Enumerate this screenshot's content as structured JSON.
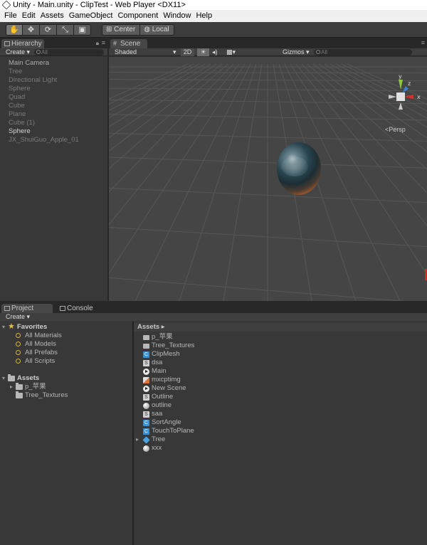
{
  "window": {
    "title": "Unity - Main.unity - ClipTest - Web Player <DX11>"
  },
  "menu": [
    "File",
    "Edit",
    "Assets",
    "GameObject",
    "Component",
    "Window",
    "Help"
  ],
  "toolbar": {
    "tools": [
      "hand-tool",
      "move-tool",
      "rotate-tool",
      "scale-tool",
      "rect-tool"
    ],
    "tool_glyphs": [
      "✋",
      "✥",
      "⟳",
      "⤡",
      "▣"
    ],
    "pivot_label": "Center",
    "space_label": "Local"
  },
  "hierarchy": {
    "tab": "Hierarchy",
    "create": "Create ▾",
    "search_placeholder": "All",
    "items": [
      {
        "label": "Main Camera",
        "style": ""
      },
      {
        "label": "Tree",
        "style": "dim"
      },
      {
        "label": "Directional Light",
        "style": "dim"
      },
      {
        "label": "Sphere",
        "style": "dim"
      },
      {
        "label": "Quad",
        "style": "dim"
      },
      {
        "label": "Cube",
        "style": "dim"
      },
      {
        "label": "Plane",
        "style": "dim"
      },
      {
        "label": "Cube (1)",
        "style": "dim"
      },
      {
        "label": "Sphere",
        "style": "bold"
      },
      {
        "label": "JX_ShuiGuo_Apple_01",
        "style": "dim"
      }
    ]
  },
  "scene": {
    "tab": "Scene",
    "shading": "Shaded",
    "mode_2d": "2D",
    "gizmos": "Gizmos ▾",
    "search_placeholder": "All",
    "projection": "Persp",
    "axes": {
      "y": "y",
      "x": "x",
      "z": "z"
    }
  },
  "project": {
    "tab": "Project",
    "console_tab": "Console",
    "create": "Create ▾",
    "favorites_label": "Favorites",
    "favorites": [
      "All Materials",
      "All Models",
      "All Prefabs",
      "All Scripts"
    ],
    "assets_label": "Assets",
    "asset_folders": [
      "p_苹果",
      "Tree_Textures"
    ],
    "breadcrumb": "Assets ▸",
    "assets": [
      {
        "label": "p_苹果",
        "icon": "folder-i",
        "glyph": ""
      },
      {
        "label": "Tree_Textures",
        "icon": "folder-i",
        "glyph": ""
      },
      {
        "label": "ClipMesh",
        "icon": "csharp",
        "glyph": "C"
      },
      {
        "label": "dsa",
        "icon": "shader",
        "glyph": "S"
      },
      {
        "label": "Main",
        "icon": "unity",
        "glyph": ""
      },
      {
        "label": "mxcptimg",
        "icon": "anim",
        "glyph": ""
      },
      {
        "label": "New Scene",
        "icon": "unity",
        "glyph": ""
      },
      {
        "label": "Outline",
        "icon": "shader",
        "glyph": "S"
      },
      {
        "label": "outline",
        "icon": "material",
        "glyph": ""
      },
      {
        "label": "saa",
        "icon": "shader",
        "glyph": "S"
      },
      {
        "label": "SortAngle",
        "icon": "csharp",
        "glyph": "C"
      },
      {
        "label": "TouchToPlane",
        "icon": "csharp",
        "glyph": "C"
      },
      {
        "label": "Tree",
        "icon": "prefab",
        "glyph": ""
      },
      {
        "label": "xxx",
        "icon": "material",
        "glyph": ""
      }
    ]
  }
}
